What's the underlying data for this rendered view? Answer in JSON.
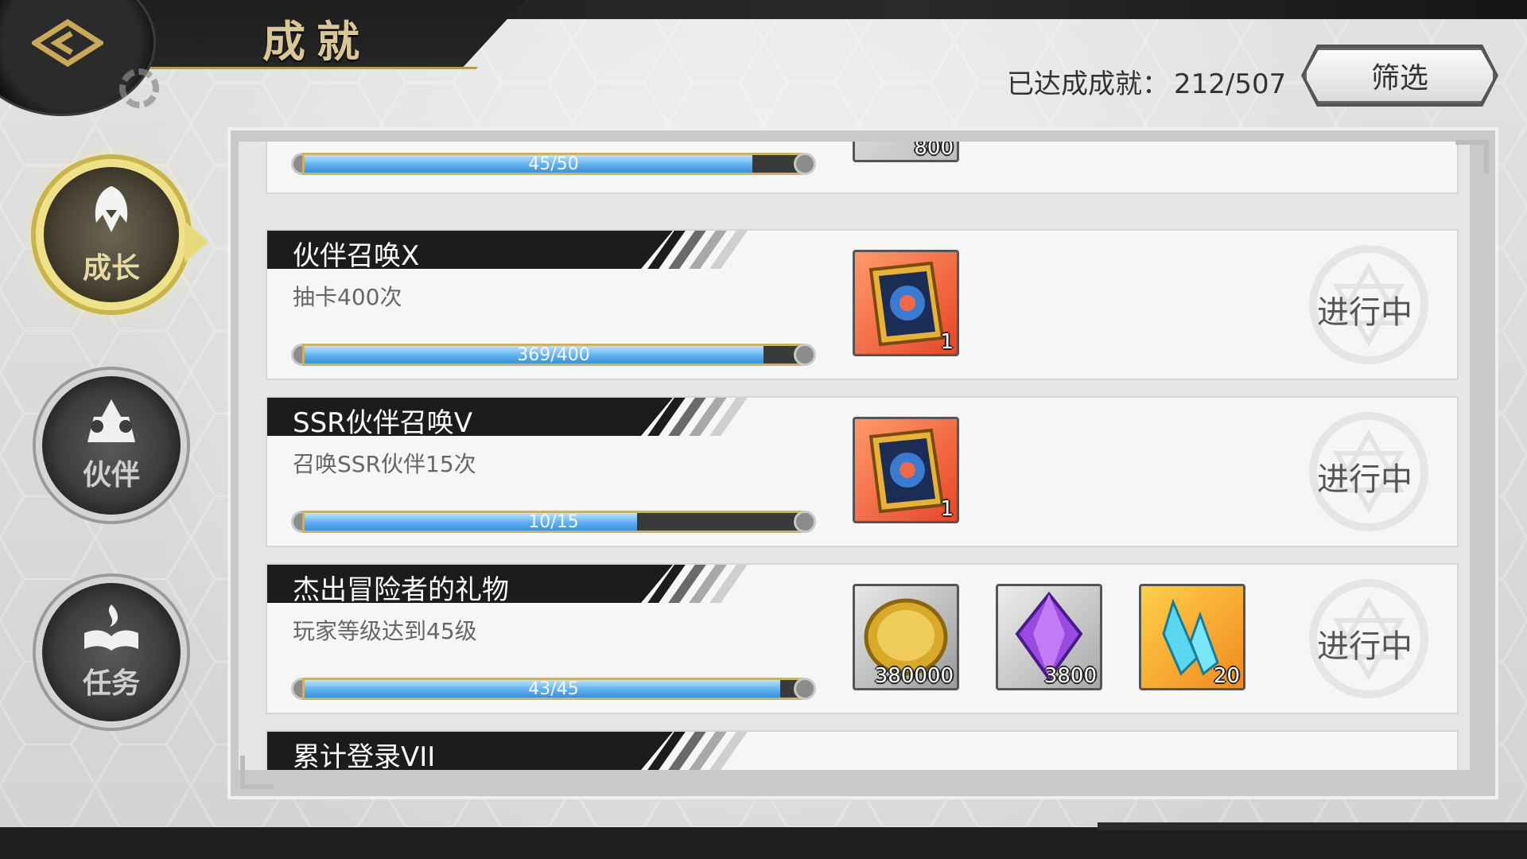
{
  "header": {
    "title": "成就",
    "back_icon": "back-arrow-icon"
  },
  "progress": {
    "label": "已达成成就：",
    "value": "212/507"
  },
  "filter_button": {
    "label": "筛选"
  },
  "side_tabs": [
    {
      "label": "成长",
      "icon": "hooded-figure-icon",
      "active": true
    },
    {
      "label": "伙伴",
      "icon": "party-members-icon",
      "active": false
    },
    {
      "label": "任务",
      "icon": "open-book-flame-icon",
      "active": false
    }
  ],
  "achievements": [
    {
      "title": "",
      "desc": "",
      "progress_text": "45/50",
      "progress": 0.9,
      "rewards": [
        {
          "icon": "purple-gem-icon",
          "qty": "800"
        }
      ],
      "status": ""
    },
    {
      "title": "伙伴召唤X",
      "desc": "抽卡400次",
      "progress_text": "369/400",
      "progress": 0.9225,
      "rewards": [
        {
          "icon": "summon-card-icon",
          "qty": "1"
        }
      ],
      "status": "进行中"
    },
    {
      "title": "SSR伙伴召唤V",
      "desc": "召唤SSR伙伴15次",
      "progress_text": "10/15",
      "progress": 0.667,
      "rewards": [
        {
          "icon": "summon-card-icon",
          "qty": "1"
        }
      ],
      "status": "进行中"
    },
    {
      "title": "杰出冒险者的礼物",
      "desc": "玩家等级达到45级",
      "progress_text": "43/45",
      "progress": 0.955,
      "rewards": [
        {
          "icon": "gold-coin-icon",
          "qty": "380000"
        },
        {
          "icon": "purple-gem-icon",
          "qty": "3800"
        },
        {
          "icon": "blue-crystal-icon",
          "qty": "20"
        }
      ],
      "status": "进行中"
    },
    {
      "title": "累计登录VII",
      "desc": "",
      "progress_text": "",
      "progress": 0,
      "rewards": [],
      "status": ""
    }
  ],
  "colors": {
    "accent_gold": "#c8b268",
    "bar_blue": "#5fb0f0",
    "header_dark": "#1c1c1c"
  }
}
